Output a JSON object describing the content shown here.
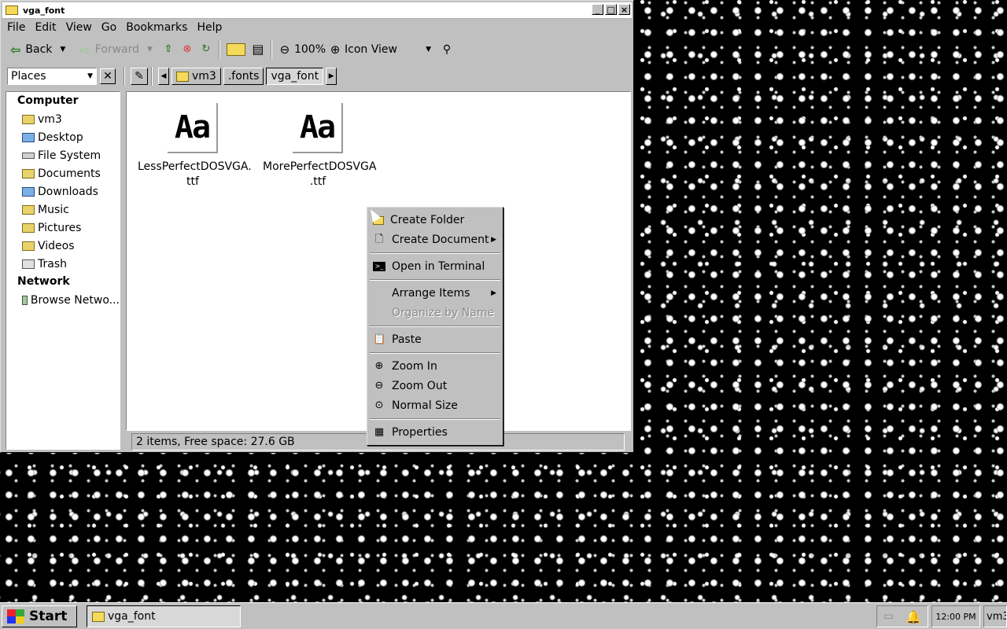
{
  "window": {
    "title": "vga_font"
  },
  "menubar": [
    "File",
    "Edit",
    "View",
    "Go",
    "Bookmarks",
    "Help"
  ],
  "toolbar": {
    "back_label": "Back",
    "forward_label": "Forward",
    "zoom_level": "100%",
    "view_mode": "Icon View"
  },
  "location": {
    "places_label": "Places",
    "crumbs": [
      "vm3",
      ".fonts",
      "vga_font"
    ]
  },
  "sidebar": {
    "computer_heading": "Computer",
    "items": [
      {
        "label": "vm3",
        "icon": "home-folder-icon"
      },
      {
        "label": "Desktop",
        "icon": "desktop-icon"
      },
      {
        "label": "File System",
        "icon": "drive-icon"
      },
      {
        "label": "Documents",
        "icon": "folder-icon"
      },
      {
        "label": "Downloads",
        "icon": "downloads-icon"
      },
      {
        "label": "Music",
        "icon": "music-folder-icon"
      },
      {
        "label": "Pictures",
        "icon": "pictures-folder-icon"
      },
      {
        "label": "Videos",
        "icon": "folder-icon"
      },
      {
        "label": "Trash",
        "icon": "trash-icon"
      }
    ],
    "network_heading": "Network",
    "network_items": [
      {
        "label": "Browse Netwo...",
        "icon": "network-icon"
      }
    ]
  },
  "files": [
    {
      "name_line1": "LessPerfectDOSVGA.",
      "name_line2": "ttf",
      "preview": "Aa"
    },
    {
      "name_line1": "MorePerfectDOSVGA",
      "name_line2": ".ttf",
      "preview": "Aa"
    }
  ],
  "status": "2 items, Free space: 27.6 GB",
  "context_menu": {
    "create_folder": "Create Folder",
    "create_document": "Create Document",
    "open_terminal": "Open in Terminal",
    "arrange_items": "Arrange Items",
    "organize_by_name": "Organize by Name",
    "paste": "Paste",
    "zoom_in": "Zoom In",
    "zoom_out": "Zoom Out",
    "normal_size": "Normal Size",
    "properties": "Properties"
  },
  "taskbar": {
    "start_label": "Start",
    "task_label": "vga_font",
    "clock": "12:00 PM",
    "user": "vm3"
  }
}
